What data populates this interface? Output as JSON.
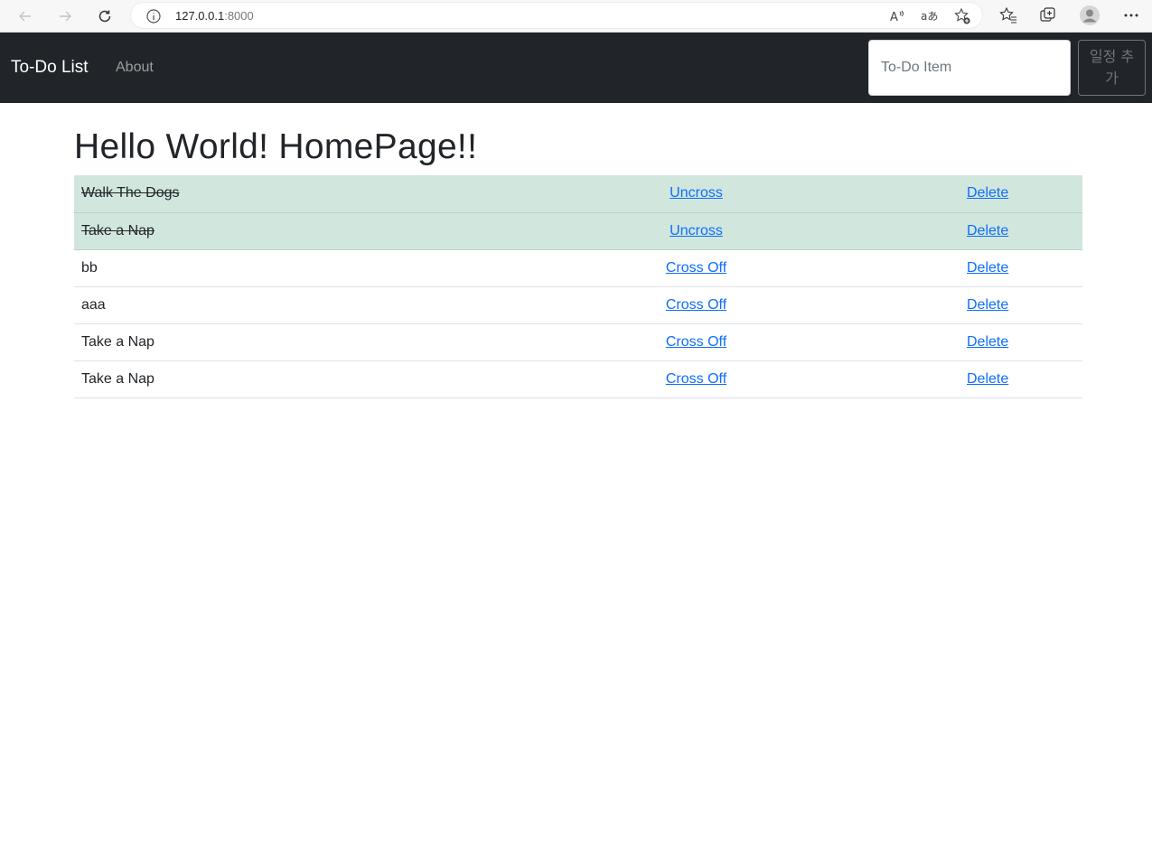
{
  "browser": {
    "url_host": "127.0.0.1",
    "url_port": ":8000"
  },
  "navbar": {
    "brand": "To-Do List",
    "about_label": "About",
    "input_placeholder": "To-Do Item",
    "add_button_label": "일정 추가"
  },
  "page": {
    "title": "Hello World! HomePage!!"
  },
  "todos": [
    {
      "item": "Walk The Dogs",
      "toggle_label": "Uncross",
      "delete_label": "Delete",
      "completed": true
    },
    {
      "item": "Take a Nap",
      "toggle_label": "Uncross",
      "delete_label": "Delete",
      "completed": true
    },
    {
      "item": "bb",
      "toggle_label": "Cross Off",
      "delete_label": "Delete",
      "completed": false
    },
    {
      "item": "aaa",
      "toggle_label": "Cross Off",
      "delete_label": "Delete",
      "completed": false
    },
    {
      "item": "Take a Nap",
      "toggle_label": "Cross Off",
      "delete_label": "Delete",
      "completed": false
    },
    {
      "item": "Take a Nap",
      "toggle_label": "Cross Off",
      "delete_label": "Delete",
      "completed": false
    }
  ],
  "colors": {
    "navbar_bg": "#212529",
    "completed_row_bg": "#d1e7dd",
    "link": "#0d6efd"
  },
  "icons": {
    "back": "arrow-left-icon",
    "forward": "arrow-right-icon",
    "reload": "refresh-icon",
    "info": "info-icon",
    "read_aloud": "read-aloud-icon",
    "translate": "translate-icon",
    "add_favorite": "star-plus-icon",
    "favorites": "favorites-icon",
    "collections": "collections-icon",
    "profile": "profile-icon",
    "more": "more-icon"
  }
}
